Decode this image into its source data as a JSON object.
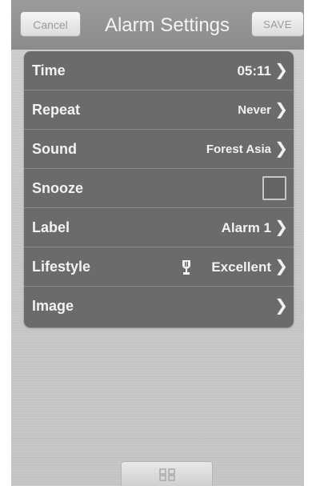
{
  "header": {
    "title": "Alarm Settings",
    "cancel_label": "Cancel",
    "save_label": "SAVE"
  },
  "settings": {
    "time": {
      "label": "Time",
      "value": "05:11"
    },
    "repeat": {
      "label": "Repeat",
      "value": "Never"
    },
    "sound": {
      "label": "Sound",
      "value": "Forest Asia"
    },
    "snooze": {
      "label": "Snooze",
      "checked": false
    },
    "label": {
      "label": "Label",
      "value": "Alarm 1"
    },
    "lifestyle": {
      "label": "Lifestyle",
      "value": "Excellent",
      "icon": "trophy-icon"
    },
    "image": {
      "label": "Image",
      "value": ""
    }
  },
  "chevron_glyph": "❯",
  "colors": {
    "header_bg": "#8f8f8f",
    "list_bg": "#6b6b6b",
    "screen_bg": "#c9c9c9",
    "text_light": "#f2f2f2"
  }
}
